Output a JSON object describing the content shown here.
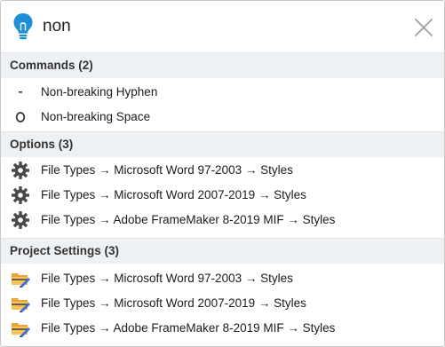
{
  "search": {
    "query": "non"
  },
  "sections": {
    "commands": {
      "title": "Commands",
      "count": "(2)",
      "items": [
        {
          "label": "Non-breaking Hyphen",
          "icon": "hyphen-icon"
        },
        {
          "label": "Non-breaking Space",
          "icon": "circle-o-icon"
        }
      ]
    },
    "options": {
      "title": "Options",
      "count": "(3)",
      "items": [
        {
          "label": "File Types → Microsoft Word 97-2003 → Styles",
          "icon": "gear-icon"
        },
        {
          "label": "File Types → Microsoft Word 2007-2019 → Styles",
          "icon": "gear-icon"
        },
        {
          "label": "File Types → Adobe FrameMaker 8-2019 MIF → Styles",
          "icon": "gear-icon"
        }
      ]
    },
    "project": {
      "title": "Project Settings",
      "count": "(3)",
      "items": [
        {
          "label": "File Types → Microsoft Word 97-2003 → Styles",
          "icon": "project-settings-icon"
        },
        {
          "label": "File Types → Microsoft Word 2007-2019 → Styles",
          "icon": "project-settings-icon"
        },
        {
          "label": "File Types → Adobe FrameMaker 8-2019 MIF → Styles",
          "icon": "project-settings-icon"
        }
      ]
    }
  },
  "colors": {
    "accent": "#1c8fd6",
    "header_bg": "#eef1f4"
  }
}
